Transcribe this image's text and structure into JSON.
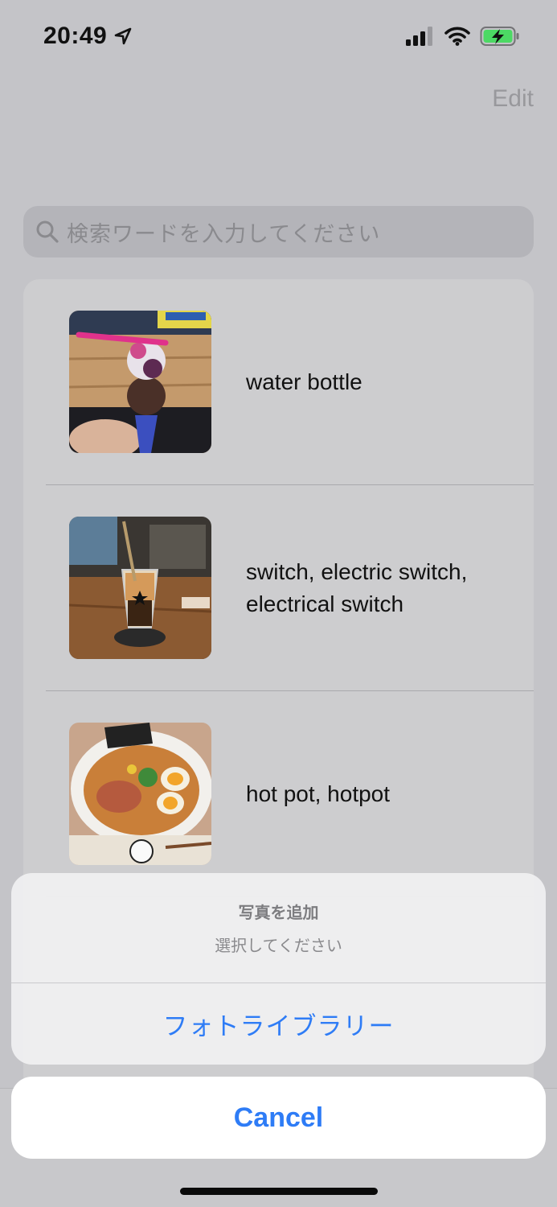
{
  "status_bar": {
    "time": "20:49",
    "icons": [
      "location-arrow-icon",
      "signal-bars-icon",
      "wifi-icon",
      "battery-charging-icon"
    ]
  },
  "nav": {
    "edit_label": "Edit"
  },
  "search": {
    "placeholder": "検索ワードを入力してください"
  },
  "list": {
    "items": [
      {
        "label": "water bottle",
        "thumbnail": "ice-cream-cone-photo"
      },
      {
        "label": "switch, electric switch, electrical switch",
        "thumbnail": "iced-coffee-glass-photo"
      },
      {
        "label": "hot pot, hotpot",
        "thumbnail": "ramen-bowl-photo"
      }
    ]
  },
  "action_sheet": {
    "title": "写真を追加",
    "message": "選択してください",
    "action_label": "フォトライブラリー",
    "cancel_label": "Cancel"
  },
  "colors": {
    "accent": "#2E7CF6",
    "dim_background": "#C4C4C8",
    "battery_green": "#4CD964"
  }
}
